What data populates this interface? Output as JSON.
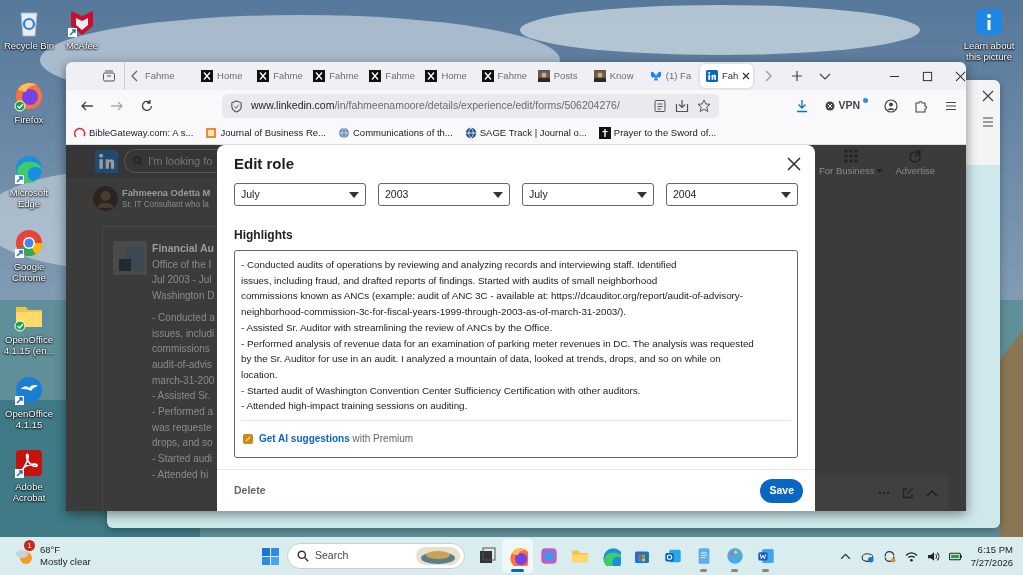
{
  "desktop_icons": [
    {
      "label": "Recycle Bin",
      "kind": "recycle"
    },
    {
      "label": "Firefox",
      "kind": "firefox"
    },
    {
      "label": "Microsoft Edge",
      "kind": "edge"
    },
    {
      "label": "Google Chrome",
      "kind": "chrome"
    },
    {
      "label": "OpenOffice 4.1.15 (en...",
      "kind": "folder"
    },
    {
      "label": "OpenOffice 4.1.15",
      "kind": "openoffice"
    },
    {
      "label": "Adobe Acrobat",
      "kind": "acrobat"
    },
    {
      "label": "McAfee",
      "kind": "mcafee"
    },
    {
      "label": "Learn about this picture",
      "kind": "learn"
    }
  ],
  "browser": {
    "tabs": [
      {
        "label": "Fahme",
        "kind": "plain",
        "selected": false
      },
      {
        "label": "Home",
        "kind": "x",
        "selected": false
      },
      {
        "label": "Fahme",
        "kind": "x",
        "selected": false
      },
      {
        "label": "Fahme",
        "kind": "x",
        "selected": false
      },
      {
        "label": "Fahme",
        "kind": "x",
        "selected": false
      },
      {
        "label": "Home",
        "kind": "x",
        "selected": false
      },
      {
        "label": "Fahme",
        "kind": "x",
        "selected": false
      },
      {
        "label": "Posts",
        "selected": false
      },
      {
        "label": "Know",
        "selected": false
      },
      {
        "label": "(1) Fa",
        "kind": "butterfly",
        "selected": false
      },
      {
        "label": "Fah",
        "kind": "linkedin",
        "selected": true
      }
    ],
    "url": {
      "host": "www.linkedin.com",
      "path": "/in/fahmeenamoore/details/experience/edit/forms/506204276/"
    },
    "vpn": "VPN",
    "bookmarks": [
      {
        "label": "BibleGateway.com: A s...",
        "kind": "arc"
      },
      {
        "label": "Journal of Business Re...",
        "kind": "journal"
      },
      {
        "label": "Communications of th...",
        "kind": "globe"
      },
      {
        "label": "SAGE Track | Journal o...",
        "kind": "sage"
      },
      {
        "label": "Prayer to the Sword of...",
        "kind": "dark"
      }
    ]
  },
  "linkedin_page": {
    "search_placeholder": "I'm looking fo",
    "profile_name": "Fahmeena Odetta M",
    "headline": "Sr. IT Consultant who la",
    "job_title": "Financial Au",
    "job_lines": [
      "Office of the I",
      "Jul 2003 - Jul",
      "Washington D"
    ],
    "description_lines": [
      "- Conducted a",
      "issues, includi",
      "commissions",
      "audit-of-advis",
      "march-31-200",
      "- Assisted Sr.",
      "- Performed a",
      "was requeste",
      "drops, and so",
      "- Started audi",
      "- Attended hi"
    ],
    "nav": [
      {
        "label": "For Business",
        "kind": "grid"
      },
      {
        "label": "Advertise",
        "kind": "advertise"
      }
    ]
  },
  "modal": {
    "title": "Edit role",
    "date_selects": [
      {
        "value": "July"
      },
      {
        "value": "2003"
      },
      {
        "value": "July"
      },
      {
        "value": "2004"
      }
    ],
    "highlights_label": "Highlights",
    "highlights_lines": [
      "- Conducted audits of operations by reviewing and analyzing records and interviewing staff. Identified",
      "issues, including fraud, and drafted reports of findings. Started with audits of small neighborhood",
      "commissions known as ANCs (example: audit of ANC 3C - available at: https://dcauditor.org/report/audit-of-advisory-",
      "neighborhood-commission-3c-for-fiscal-years-1999-through-2003-as-of-march-31-2003/).",
      "- Assisted Sr. Auditor with streamlining the review of ANCs by the Office.",
      "- Performed analysis of revenue data for an examination of parking meter revenues in DC. The analysis was requested",
      "by the Sr. Auditor for use in an audit. I analyzed a mountain of data, looked at trends, drops, and so on while on",
      "location.",
      "- Started audit of Washington Convention Center Sufficiency Certification with other auditors.",
      "- Attended high-impact training sessions on auditing."
    ],
    "ai_link": "Get AI suggestions",
    "ai_suffix": "with Premium",
    "delete": "Delete",
    "save": "Save"
  },
  "taskbar": {
    "weather_badge": "1",
    "temperature": "68°F",
    "condition": "Mostly clear",
    "search_placeholder": "Search",
    "apps": [
      {
        "kind": "taskview",
        "selected": false
      },
      {
        "kind": "firefox",
        "selected": true
      },
      {
        "kind": "m365",
        "selected": false
      },
      {
        "kind": "explorer",
        "selected": false
      },
      {
        "kind": "edge",
        "selected": false
      },
      {
        "kind": "store",
        "selected": false
      },
      {
        "kind": "outlook",
        "selected": false
      },
      {
        "kind": "notepad",
        "selected": false
      },
      {
        "kind": "paint",
        "selected": false
      },
      {
        "kind": "word",
        "selected": false
      }
    ],
    "time": "6:15 PM",
    "date": "7/27/2026"
  }
}
